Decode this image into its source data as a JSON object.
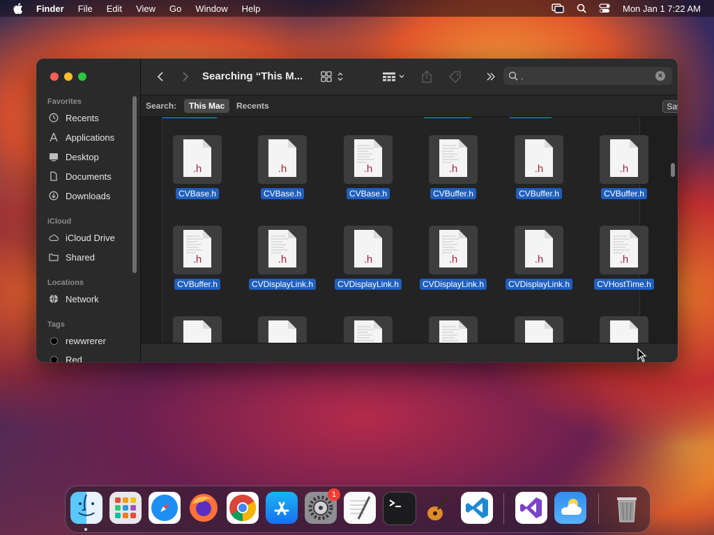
{
  "menubar": {
    "app_name": "Finder",
    "menus": [
      "File",
      "Edit",
      "View",
      "Go",
      "Window",
      "Help"
    ],
    "clock": "Mon Jan 1  7:22 AM"
  },
  "sidebar": {
    "favorites_header": "Favorites",
    "favorites": [
      {
        "label": "Recents",
        "icon": "clock-icon"
      },
      {
        "label": "Applications",
        "icon": "applications-icon"
      },
      {
        "label": "Desktop",
        "icon": "desktop-icon"
      },
      {
        "label": "Documents",
        "icon": "document-icon"
      },
      {
        "label": "Downloads",
        "icon": "download-icon"
      }
    ],
    "icloud_header": "iCloud",
    "icloud": [
      {
        "label": "iCloud Drive",
        "icon": "cloud-icon"
      },
      {
        "label": "Shared",
        "icon": "shared-folder-icon"
      }
    ],
    "locations_header": "Locations",
    "locations": [
      {
        "label": "Network",
        "icon": "globe-icon"
      }
    ],
    "tags_header": "Tags",
    "tags": [
      {
        "label": "rewwrerer"
      },
      {
        "label": "Red"
      }
    ]
  },
  "toolbar": {
    "title": "Searching “This M..."
  },
  "search": {
    "value": "."
  },
  "searchbar": {
    "label": "Search:",
    "scope_this_mac": "This Mac",
    "scope_recents": "Recents",
    "save_label": "Save",
    "add_label": "+"
  },
  "files": [
    {
      "name": "CVBase.h",
      "ext": ".h",
      "lines": false
    },
    {
      "name": "CVBase.h",
      "ext": ".h",
      "lines": false
    },
    {
      "name": "CVBase.h",
      "ext": ".h",
      "lines": true
    },
    {
      "name": "CVBuffer.h",
      "ext": ".h",
      "lines": true
    },
    {
      "name": "CVBuffer.h",
      "ext": ".h",
      "lines": false
    },
    {
      "name": "CVBuffer.h",
      "ext": ".h",
      "lines": false
    },
    {
      "name": "CVBuffer.h",
      "ext": ".h",
      "lines": true
    },
    {
      "name": "CVDisplayLink.h",
      "ext": ".h",
      "lines": true
    },
    {
      "name": "CVDisplayLink.h",
      "ext": ".h",
      "lines": false
    },
    {
      "name": "CVDisplayLink.h",
      "ext": ".h",
      "lines": true
    },
    {
      "name": "CVDisplayLink.h",
      "ext": ".h",
      "lines": false
    },
    {
      "name": "CVHostTime.h",
      "ext": ".h",
      "lines": true
    }
  ],
  "dock": {
    "apps": [
      "Finder",
      "Launchpad",
      "Safari",
      "Firefox",
      "Chrome",
      "App Store",
      "System Settings",
      "TextEdit",
      "Terminal",
      "GarageBand",
      "Visual Studio Code",
      "Visual Studio",
      "Weather",
      "Trash"
    ],
    "settings_badge": "1"
  },
  "colors": {
    "selection": "#1f5fbf",
    "header_ext": "#a3263c"
  }
}
